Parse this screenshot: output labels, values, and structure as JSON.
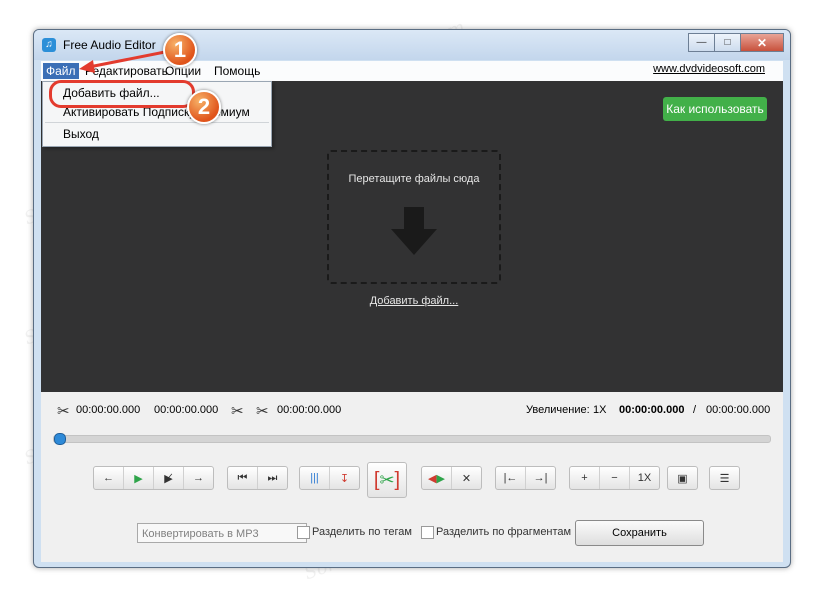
{
  "window": {
    "title": "Free Audio Editor",
    "app_icon": "music-note-icon",
    "controls": [
      "minimize-icon",
      "maximize-icon",
      "close-icon"
    ]
  },
  "menubar": {
    "items": [
      {
        "label": "Файл"
      },
      {
        "label": "Редактировать"
      },
      {
        "label": "Опции"
      },
      {
        "label": "Помощь"
      }
    ],
    "site_link": "www.dvdvideosoft.com"
  },
  "file_menu": {
    "items": [
      {
        "label": "Добавить файл..."
      },
      {
        "label": "Активировать Подписку Премиум"
      },
      {
        "label": "Выход"
      }
    ]
  },
  "main": {
    "howto_button": "Как использовать",
    "drop_text": "Перетащите файлы сюда",
    "add_file_link": "Добавить файл..."
  },
  "timeline": {
    "selection_start": "00:00:00.000",
    "selection_end": "00:00:00.000",
    "cut_length": "00:00:00.000",
    "zoom_label": "Увеличение:",
    "zoom_value": "1X",
    "position": "00:00:00.000",
    "separator": "/",
    "duration": "00:00:00.000",
    "progress_fraction": 0.0
  },
  "toolbar": {
    "zoom_button": "1X"
  },
  "footer": {
    "format_select": "Конвертировать в MP3",
    "split_by_tags": "Разделить по тегам",
    "split_by_fragments": "Разделить по фрагментам",
    "save_button": "Сохранить"
  },
  "annotations": {
    "callout_1": "1",
    "callout_2": "2"
  },
  "watermark_text": "Soringpcrpair.com",
  "colors": {
    "accent_green": "#42b049",
    "menu_active": "#3b6fb6",
    "callout_orange": "#e0541b",
    "highlight_red": "#e33b2e",
    "dark_panel": "#323233"
  }
}
